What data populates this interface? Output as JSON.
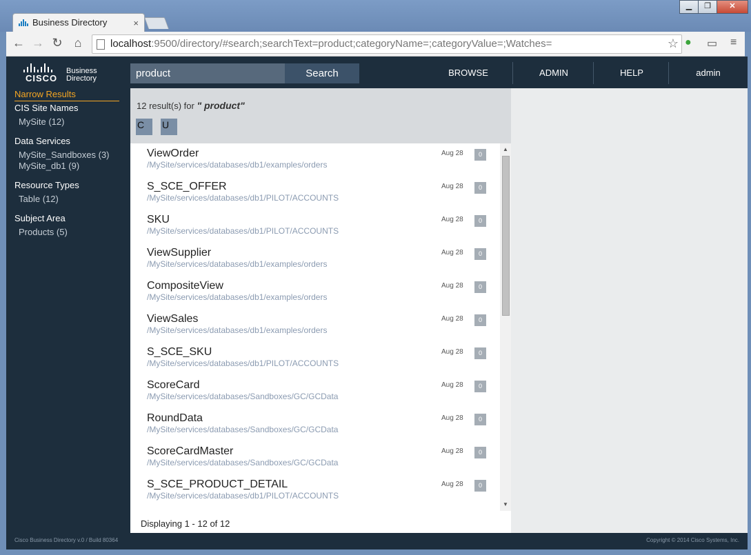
{
  "browser": {
    "tab_title": "Business Directory",
    "tab_close": "×",
    "url_host": "localhost",
    "url_rest": ":9500/directory/#search;searchText=product;categoryName=;categoryValue=;Watches=",
    "window_buttons": [
      "▁",
      "❐",
      "✕"
    ]
  },
  "header": {
    "logo_word": "CISCO",
    "logo_line1": "Business",
    "logo_line2": "Directory",
    "search_value": "product",
    "search_button": "Search",
    "nav": [
      "BROWSE",
      "ADMIN",
      "HELP",
      "admin"
    ]
  },
  "sidebar": {
    "title": "Narrow Results",
    "groups": [
      {
        "heading": "CIS Site Names",
        "items": [
          "MySite (12)"
        ]
      },
      {
        "heading": "Data Services",
        "items": [
          "MySite_Sandboxes (3)",
          "MySite_db1 (9)"
        ]
      },
      {
        "heading": "Resource Types",
        "items": [
          "Table (12)"
        ]
      },
      {
        "heading": "Subject Area",
        "items": [
          "Products (5)"
        ]
      }
    ]
  },
  "results": {
    "count_text": "12 result(s) for",
    "query_text": "\" product\"",
    "sort_buttons": [
      "C",
      "U"
    ],
    "rows": [
      {
        "name": "ViewOrder",
        "path": "/MySite/services/databases/db1/examples/orders",
        "date": "Aug 28",
        "badge": "0"
      },
      {
        "name": "S_SCE_OFFER",
        "path": "/MySite/services/databases/db1/PILOT/ACCOUNTS",
        "date": "Aug 28",
        "badge": "0"
      },
      {
        "name": "SKU",
        "path": "/MySite/services/databases/db1/PILOT/ACCOUNTS",
        "date": "Aug 28",
        "badge": "0"
      },
      {
        "name": "ViewSupplier",
        "path": "/MySite/services/databases/db1/examples/orders",
        "date": "Aug 28",
        "badge": "0"
      },
      {
        "name": "CompositeView",
        "path": "/MySite/services/databases/db1/examples/orders",
        "date": "Aug 28",
        "badge": "0"
      },
      {
        "name": "ViewSales",
        "path": "/MySite/services/databases/db1/examples/orders",
        "date": "Aug 28",
        "badge": "0"
      },
      {
        "name": "S_SCE_SKU",
        "path": "/MySite/services/databases/db1/PILOT/ACCOUNTS",
        "date": "Aug 28",
        "badge": "0"
      },
      {
        "name": "ScoreCard",
        "path": "/MySite/services/databases/Sandboxes/GC/GCData",
        "date": "Aug 28",
        "badge": "0"
      },
      {
        "name": "RoundData",
        "path": "/MySite/services/databases/Sandboxes/GC/GCData",
        "date": "Aug 28",
        "badge": "0"
      },
      {
        "name": "ScoreCardMaster",
        "path": "/MySite/services/databases/Sandboxes/GC/GCData",
        "date": "Aug 28",
        "badge": "0"
      },
      {
        "name": "S_SCE_PRODUCT_DETAIL",
        "path": "/MySite/services/databases/db1/PILOT/ACCOUNTS",
        "date": "Aug 28",
        "badge": "0"
      }
    ],
    "displaying": "Displaying 1 - 12 of 12"
  },
  "footer": {
    "left": "Cisco Business Directory v.0 / Build 80364",
    "right": "Copyright © 2014 Cisco Systems, Inc."
  },
  "colors": {
    "brand_dark": "#1d2e3d",
    "accent": "#f5a623",
    "search_field": "#57697c",
    "link_path": "#8b9bb1"
  }
}
